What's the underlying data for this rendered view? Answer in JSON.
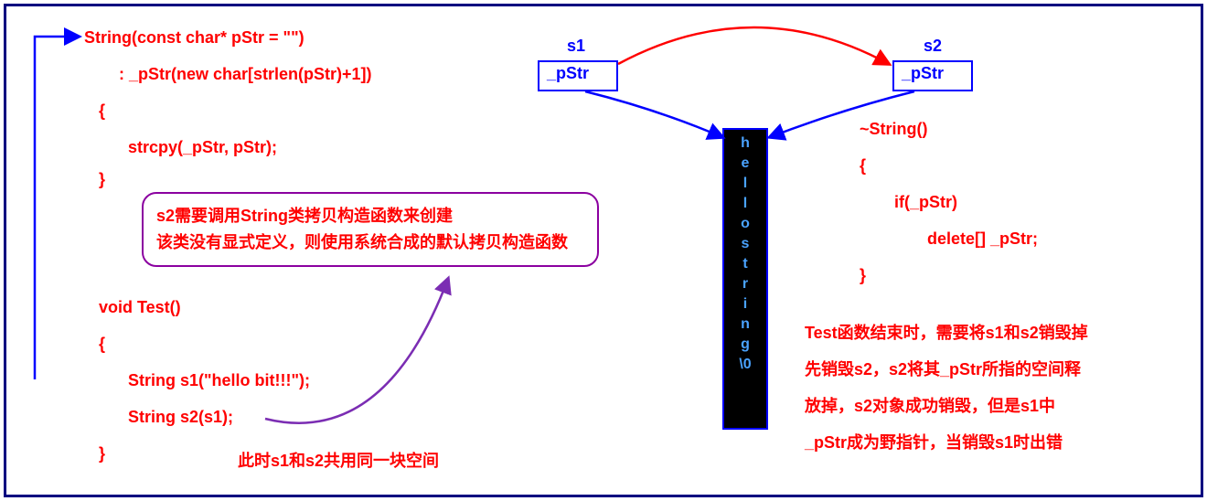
{
  "code": {
    "ctor_sig": "String(const char* pStr = \"\")",
    "ctor_init": ": _pStr(new char[strlen(pStr)+1])",
    "ctor_open": "{",
    "ctor_body": "strcpy(_pStr, pStr);",
    "ctor_close": "}",
    "test_sig": "void Test()",
    "test_open": "{",
    "test_s1": "String s1(\"hello bit!!!\");",
    "test_s2": "String s2(s1);",
    "test_close": "}"
  },
  "dtor": {
    "sig": "~String()",
    "open": "{",
    "cond": "if(_pStr)",
    "body": "delete[] _pStr;",
    "close": "}"
  },
  "boxes": {
    "s1_label": "s1",
    "s1_text": "_pStr",
    "s2_label": "s2",
    "s2_text": "_pStr"
  },
  "memory": {
    "chars": [
      "h",
      "e",
      "l",
      "l",
      "o",
      " ",
      "s",
      "t",
      "r",
      "i",
      "n",
      "g",
      "\\0"
    ]
  },
  "callout": {
    "l1": "s2需要调用String类拷贝构造函数来创建",
    "l2": "该类没有显式定义，则使用系统合成的默认拷贝构造函数"
  },
  "notes": {
    "bottom": "此时s1和s2共用同一块空间",
    "r1": "Test函数结束时，需要将s1和s2销毁掉",
    "r2": "先销毁s2，s2将其_pStr所指的空间释",
    "r3": "放掉，s2对象成功销毁，但是s1中",
    "r4": "_pStr成为野指针，当销毁s1时出错"
  }
}
